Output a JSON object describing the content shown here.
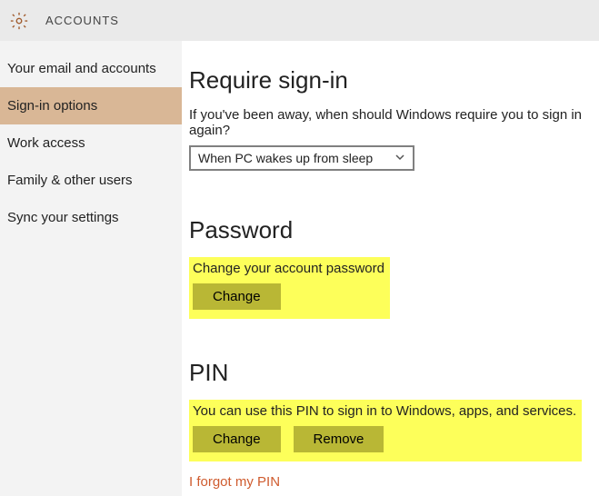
{
  "header": {
    "title": "ACCOUNTS"
  },
  "sidebar": {
    "items": [
      {
        "label": "Your email and accounts",
        "name": "nav-email"
      },
      {
        "label": "Sign-in options",
        "name": "nav-signin",
        "selected": true
      },
      {
        "label": "Work access",
        "name": "nav-work"
      },
      {
        "label": "Family & other users",
        "name": "nav-family"
      },
      {
        "label": "Sync your settings",
        "name": "nav-sync"
      }
    ]
  },
  "content": {
    "require_signin": {
      "heading": "Require sign-in",
      "description": "If you've been away, when should Windows require you to sign in again?",
      "select_value": "When PC wakes up from sleep"
    },
    "password": {
      "heading": "Password",
      "description": "Change your account password",
      "change_label": "Change"
    },
    "pin": {
      "heading": "PIN",
      "description": "You can use this PIN to sign in to Windows, apps, and services.",
      "change_label": "Change",
      "remove_label": "Remove",
      "forgot_link": "I forgot my PIN"
    }
  }
}
